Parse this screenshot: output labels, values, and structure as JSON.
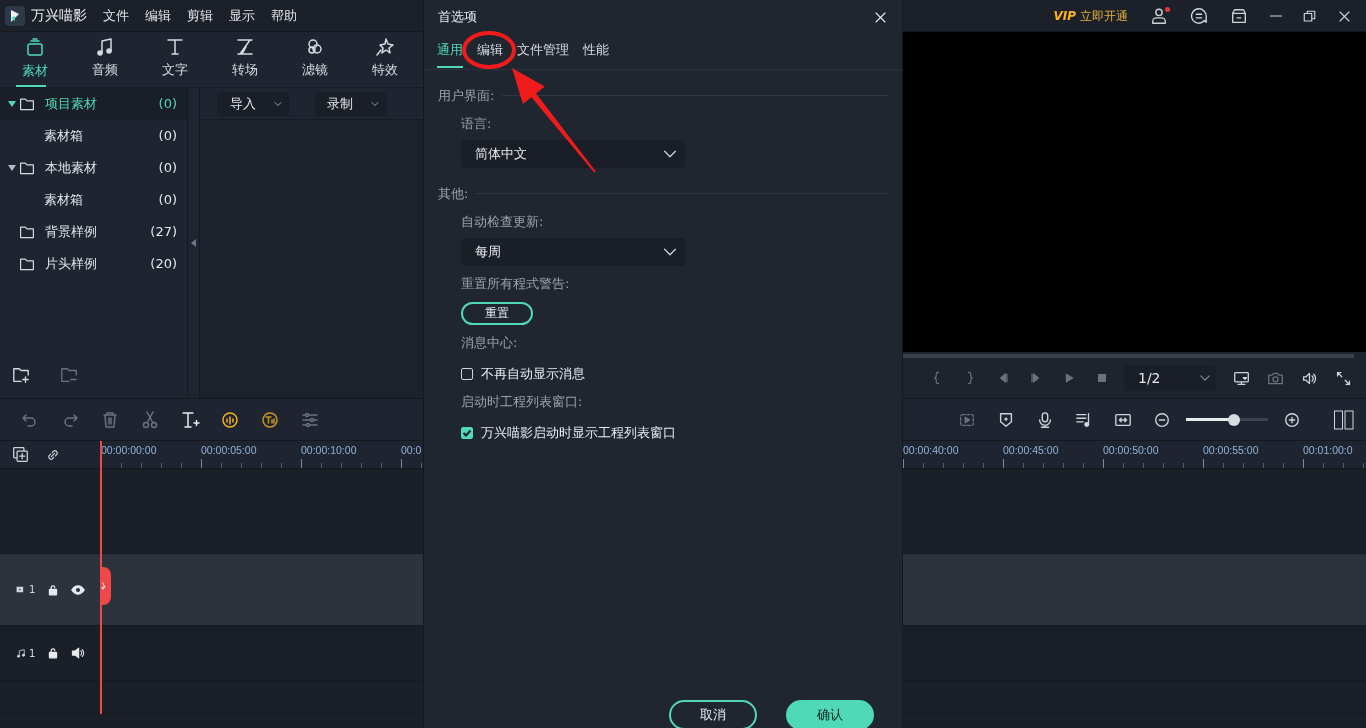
{
  "app": {
    "name": "万兴喵影"
  },
  "menu": [
    "文件",
    "编辑",
    "剪辑",
    "显示",
    "帮助"
  ],
  "vip": {
    "badge": "VIP",
    "label": "立即开通"
  },
  "account": {
    "has_notification": true
  },
  "media_tabs": [
    {
      "label": "素材",
      "selected": true
    },
    {
      "label": "音频",
      "selected": false
    },
    {
      "label": "文字",
      "selected": false
    },
    {
      "label": "转场",
      "selected": false
    },
    {
      "label": "滤镜",
      "selected": false
    },
    {
      "label": "特效",
      "selected": false
    }
  ],
  "tree": [
    {
      "label": "项目素材",
      "count": "(0)",
      "selected": true,
      "expanded": true,
      "children": [
        {
          "label": "素材箱",
          "count": "(0)",
          "selected": false
        }
      ]
    },
    {
      "label": "本地素材",
      "count": "(0)",
      "selected": false,
      "expanded": true,
      "children": [
        {
          "label": "素材箱",
          "count": "(0)",
          "selected": false
        }
      ]
    },
    {
      "label": "背景样例",
      "count": "(27)",
      "selected": false
    },
    {
      "label": "片头样例",
      "count": "(20)",
      "selected": false
    }
  ],
  "media_toolbar": [
    {
      "label": "导入"
    },
    {
      "label": "录制"
    }
  ],
  "playback": {
    "page": "1/2"
  },
  "zoom_slider": {
    "level": 0.59
  },
  "ruler": {
    "left": [
      "00:00:00:00",
      "00:00:05:00",
      "00:00:10:00",
      "00:0"
    ],
    "right": [
      "00:00:40:00",
      "00:00:45:00",
      "00:00:50:00",
      "00:00:55:00",
      "00:01:00:0"
    ]
  },
  "tracks": [
    {
      "kind": "empty"
    },
    {
      "kind": "video",
      "number": "1"
    },
    {
      "kind": "audio",
      "number": "1"
    },
    {
      "kind": "empty"
    }
  ],
  "dialog": {
    "title": "首选项",
    "tabs": [
      {
        "label": "通用",
        "selected": true
      },
      {
        "label": "编辑",
        "selected": false
      },
      {
        "label": "文件管理",
        "selected": false
      },
      {
        "label": "性能",
        "selected": false
      }
    ],
    "sections": [
      {
        "heading": "用户界面:",
        "items": [
          {
            "kind": "label",
            "text": "语言:"
          },
          {
            "kind": "select",
            "value": "简体中文"
          }
        ]
      },
      {
        "heading": "其他:",
        "items": [
          {
            "kind": "label",
            "text": "自动检查更新:"
          },
          {
            "kind": "select",
            "value": "每周"
          },
          {
            "kind": "label",
            "text": "重置所有程式警告:"
          },
          {
            "kind": "button",
            "label": "重置"
          },
          {
            "kind": "label",
            "text": "消息中心:"
          },
          {
            "kind": "checkbox",
            "label": "不再自动显示消息",
            "checked": false
          },
          {
            "kind": "label",
            "text": "启动时工程列表窗口:"
          },
          {
            "kind": "checkbox",
            "label": "万兴喵影启动时显示工程列表窗口",
            "checked": true
          }
        ]
      }
    ],
    "buttons": [
      {
        "label": "取消",
        "kind": "secondary"
      },
      {
        "label": "确认",
        "kind": "primary"
      }
    ]
  }
}
